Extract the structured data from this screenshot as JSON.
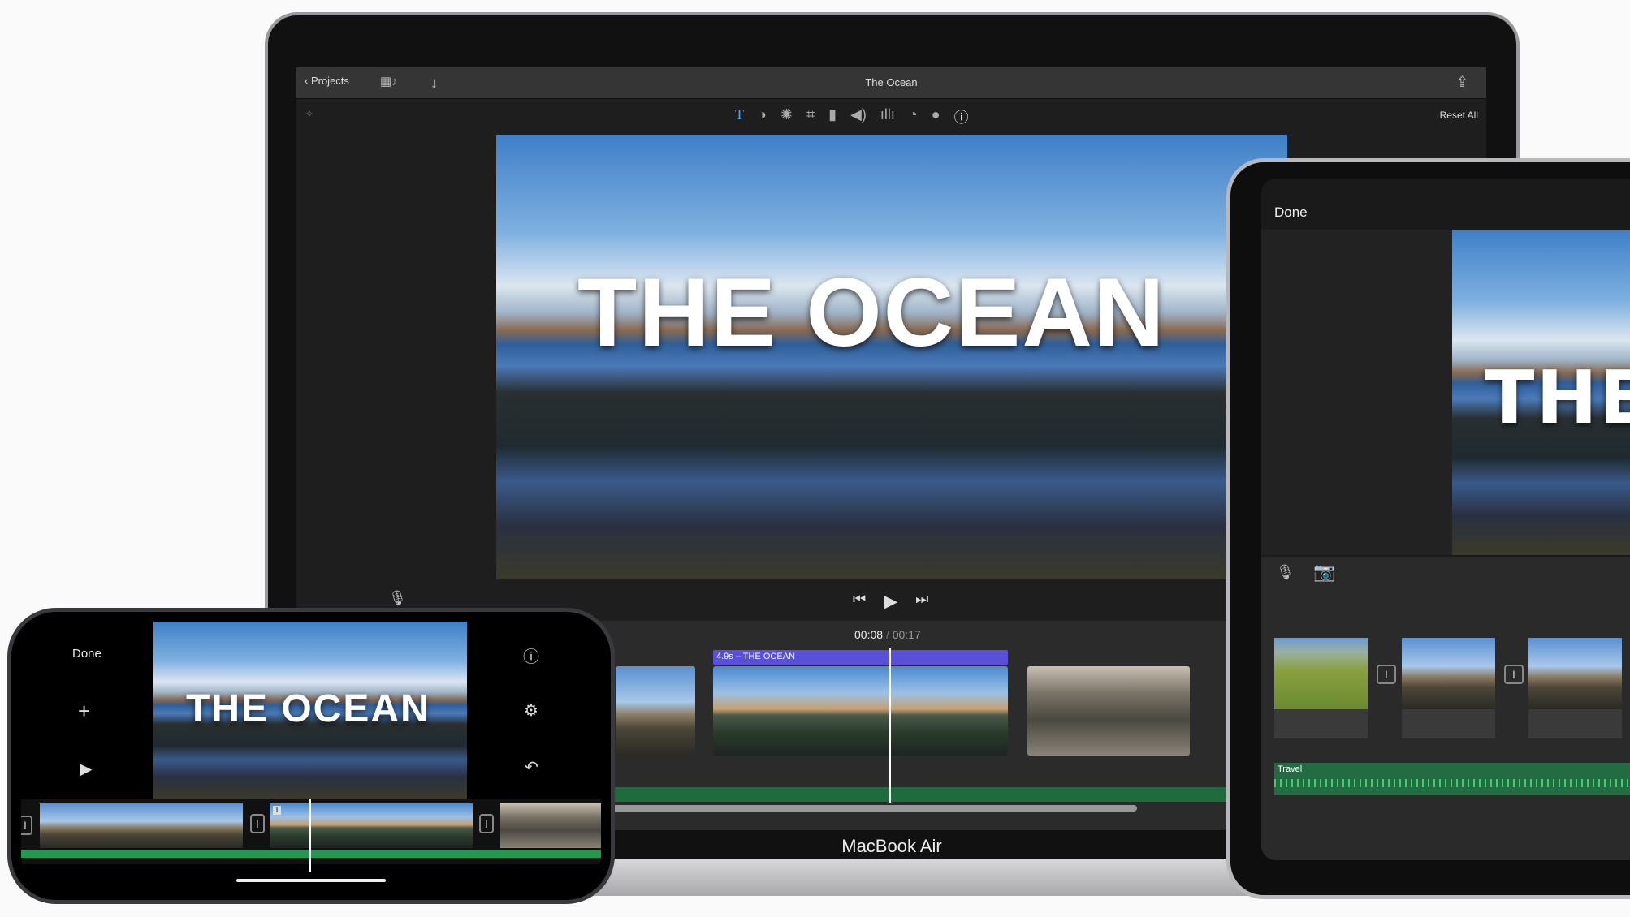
{
  "mac": {
    "back_label": "Projects",
    "window_title": "The Ocean",
    "reset_label": "Reset All",
    "preview_title": "THE OCEAN",
    "time_current": "00:08",
    "time_separator": "/",
    "time_total": "00:17",
    "clip_label": "4.9s – THE OCEAN",
    "device_label": "MacBook Air",
    "toolbar_icons": [
      "title-icon",
      "color-balance-icon",
      "color-correction-icon",
      "crop-icon",
      "stabilization-icon",
      "volume-icon",
      "equalizer-icon",
      "speed-icon",
      "filter-icon",
      "info-icon"
    ],
    "accent": "#5a4fd8",
    "audio_color": "#1e6b3e"
  },
  "ipad": {
    "done_label": "Done",
    "preview_title": "THE",
    "audio_label": "Travel"
  },
  "iphone": {
    "done_label": "Done",
    "preview_title": "THE OCEAN"
  }
}
